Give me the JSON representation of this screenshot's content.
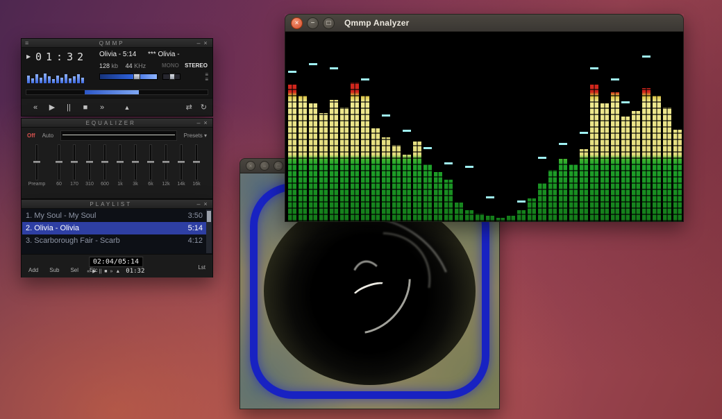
{
  "colors": {
    "accent_blue": "#3f6fd8",
    "selected_row_blue": "#2e3fa3",
    "eq_off_red": "#d9534f",
    "analyzer_green": "#1fa32a",
    "analyzer_yellow": "#efe98f",
    "analyzer_red": "#e03a2b",
    "peak_cyan": "#9ff0f2",
    "close_button_orange": "#d8502f",
    "wallpaper_purple": "#4e2750",
    "wallpaper_red": "#a34a57"
  },
  "player": {
    "titlebar": {
      "menu_icon": "≡",
      "title": "QMMP",
      "minimize": "–",
      "close": "×"
    },
    "display": {
      "play_icon": "▶",
      "time": "01:32",
      "track_text": "Olivia - 5:14      *** Olivia -",
      "bitrate": "128",
      "bitrate_unit": "kb",
      "samplerate": "44",
      "samplerate_unit": "KHz",
      "mono": "MONO",
      "stereo": "STEREO",
      "eq_button": "≡",
      "pl_button": "≡"
    },
    "mini_vis": [
      0.8,
      0.5,
      0.9,
      0.6,
      1.0,
      0.7,
      0.4,
      0.8,
      0.6,
      0.9,
      0.5,
      0.7,
      0.9,
      0.6
    ],
    "transport": [
      {
        "name": "previous",
        "glyph": "«"
      },
      {
        "name": "play",
        "glyph": "▶"
      },
      {
        "name": "pause",
        "glyph": "||"
      },
      {
        "name": "stop",
        "glyph": "■"
      },
      {
        "name": "next",
        "glyph": "»"
      },
      {
        "name": "eject",
        "glyph": "▲"
      }
    ],
    "modes": [
      {
        "name": "shuffle",
        "glyph": "⇄"
      },
      {
        "name": "repeat",
        "glyph": "↻"
      }
    ],
    "progress_percent": 32,
    "volume_percent": 62
  },
  "equalizer": {
    "titlebar": {
      "title": "EQUALIZER",
      "shade": "–",
      "close": "×"
    },
    "on_off": "Off",
    "auto": "Auto",
    "presets": "Presets ▾",
    "preamp_label": "Preamp",
    "band_labels": [
      "60",
      "170",
      "310",
      "600",
      "1k",
      "3k",
      "6k",
      "12k",
      "14k",
      "16k"
    ]
  },
  "playlist": {
    "titlebar": {
      "title": "PLAYLIST",
      "shade": "–",
      "close": "×"
    },
    "items": [
      {
        "num": "1.",
        "title": "My Soul - My Soul",
        "time": "3:50",
        "selected": false
      },
      {
        "num": "2.",
        "title": "Olivia - Olivia",
        "time": "5:14",
        "selected": true
      },
      {
        "num": "3.",
        "title": "Scarborough Fair - Scarb",
        "time": "4:12",
        "selected": false
      }
    ],
    "footer": {
      "buttons": [
        "Add",
        "Sub",
        "Sel",
        "Etc"
      ],
      "lcd": "02:04/05:14",
      "transport": [
        {
          "name": "previous",
          "glyph": "«"
        },
        {
          "name": "play",
          "glyph": "▶"
        },
        {
          "name": "pause",
          "glyph": "||"
        },
        {
          "name": "stop",
          "glyph": "■"
        },
        {
          "name": "next",
          "glyph": "»"
        },
        {
          "name": "eject",
          "glyph": "▲"
        }
      ],
      "mini_time": "01:32",
      "list_button": "Lst"
    }
  },
  "analyzer": {
    "title": "Qmmp Analyzer",
    "titlebar": {
      "close": "×",
      "minimize": "−",
      "maximize": "□"
    },
    "bars": [
      {
        "h": 0.72,
        "p": 0.78
      },
      {
        "h": 0.66
      },
      {
        "h": 0.62,
        "p": 0.82
      },
      {
        "h": 0.57
      },
      {
        "h": 0.64,
        "p": 0.8
      },
      {
        "h": 0.6
      },
      {
        "h": 0.73
      },
      {
        "h": 0.66,
        "p": 0.74
      },
      {
        "h": 0.49
      },
      {
        "h": 0.44,
        "p": 0.55
      },
      {
        "h": 0.4
      },
      {
        "h": 0.35,
        "p": 0.47
      },
      {
        "h": 0.42
      },
      {
        "h": 0.3,
        "p": 0.38
      },
      {
        "h": 0.26
      },
      {
        "h": 0.22,
        "p": 0.3
      },
      {
        "h": 0.1
      },
      {
        "h": 0.06,
        "p": 0.28
      },
      {
        "h": 0.04
      },
      {
        "h": 0.03,
        "p": 0.12
      },
      {
        "h": 0.02
      },
      {
        "h": 0.03
      },
      {
        "h": 0.06,
        "p": 0.1
      },
      {
        "h": 0.12
      },
      {
        "h": 0.2,
        "p": 0.33
      },
      {
        "h": 0.27
      },
      {
        "h": 0.33,
        "p": 0.4
      },
      {
        "h": 0.3
      },
      {
        "h": 0.38,
        "p": 0.46
      },
      {
        "h": 0.72,
        "p": 0.8
      },
      {
        "h": 0.62
      },
      {
        "h": 0.68,
        "p": 0.74
      },
      {
        "h": 0.55,
        "p": 0.62
      },
      {
        "h": 0.58
      },
      {
        "h": 0.7,
        "p": 0.86
      },
      {
        "h": 0.66
      },
      {
        "h": 0.6
      },
      {
        "h": 0.48
      }
    ]
  },
  "visualization": {
    "titlebar": {
      "close": "×",
      "minimize": "−",
      "maximize": "□"
    }
  }
}
